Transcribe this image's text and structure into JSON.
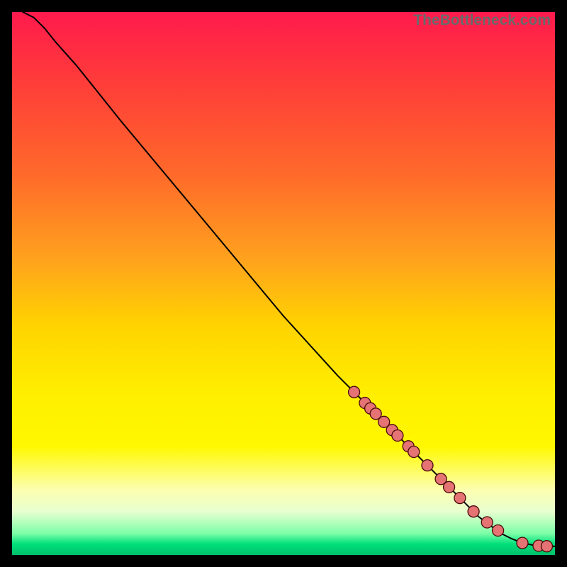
{
  "attribution": "TheBottleneck.com",
  "chart_data": {
    "type": "line",
    "title": "",
    "xlabel": "",
    "ylabel": "",
    "xlim": [
      0,
      100
    ],
    "ylim": [
      0,
      100
    ],
    "grid": false,
    "legend": false,
    "background_gradient_stops": [
      {
        "pos": 0,
        "color": "#ff1a4d"
      },
      {
        "pos": 12,
        "color": "#ff3a3a"
      },
      {
        "pos": 30,
        "color": "#ff6a2a"
      },
      {
        "pos": 45,
        "color": "#ffa01e"
      },
      {
        "pos": 58,
        "color": "#ffd400"
      },
      {
        "pos": 70,
        "color": "#ffee00"
      },
      {
        "pos": 80,
        "color": "#fff800"
      },
      {
        "pos": 88,
        "color": "#fcffb0"
      },
      {
        "pos": 92,
        "color": "#e8ffd0"
      },
      {
        "pos": 96,
        "color": "#7effa8"
      },
      {
        "pos": 98,
        "color": "#00e07a"
      },
      {
        "pos": 100,
        "color": "#00c06a"
      }
    ],
    "series": [
      {
        "name": "curve",
        "type": "line",
        "color": "#000000",
        "x": [
          2,
          4,
          6,
          8,
          12,
          20,
          30,
          40,
          50,
          60,
          66,
          70,
          74,
          78,
          82,
          86,
          88,
          90,
          92,
          94,
          96,
          98,
          100
        ],
        "y": [
          100,
          99,
          97,
          94.5,
          90,
          80,
          68,
          56,
          44,
          33,
          27,
          23,
          19,
          15,
          11,
          7,
          5.5,
          4,
          3,
          2.2,
          1.8,
          1.6,
          1.6
        ]
      },
      {
        "name": "highlighted-points",
        "type": "scatter",
        "marker_color": "#e57373",
        "marker_outline": "#4a0a0a",
        "marker_radius": 8,
        "x": [
          63,
          65,
          66,
          67,
          68.5,
          70,
          71,
          73,
          74,
          76.5,
          79,
          80.5,
          82.5,
          85,
          87.5,
          89.5,
          94,
          97,
          98.5
        ],
        "y": [
          30,
          28,
          27,
          26,
          24.5,
          23,
          22,
          20,
          19,
          16.5,
          14,
          12.5,
          10.5,
          8,
          6,
          4.5,
          2.2,
          1.7,
          1.6
        ]
      }
    ]
  }
}
